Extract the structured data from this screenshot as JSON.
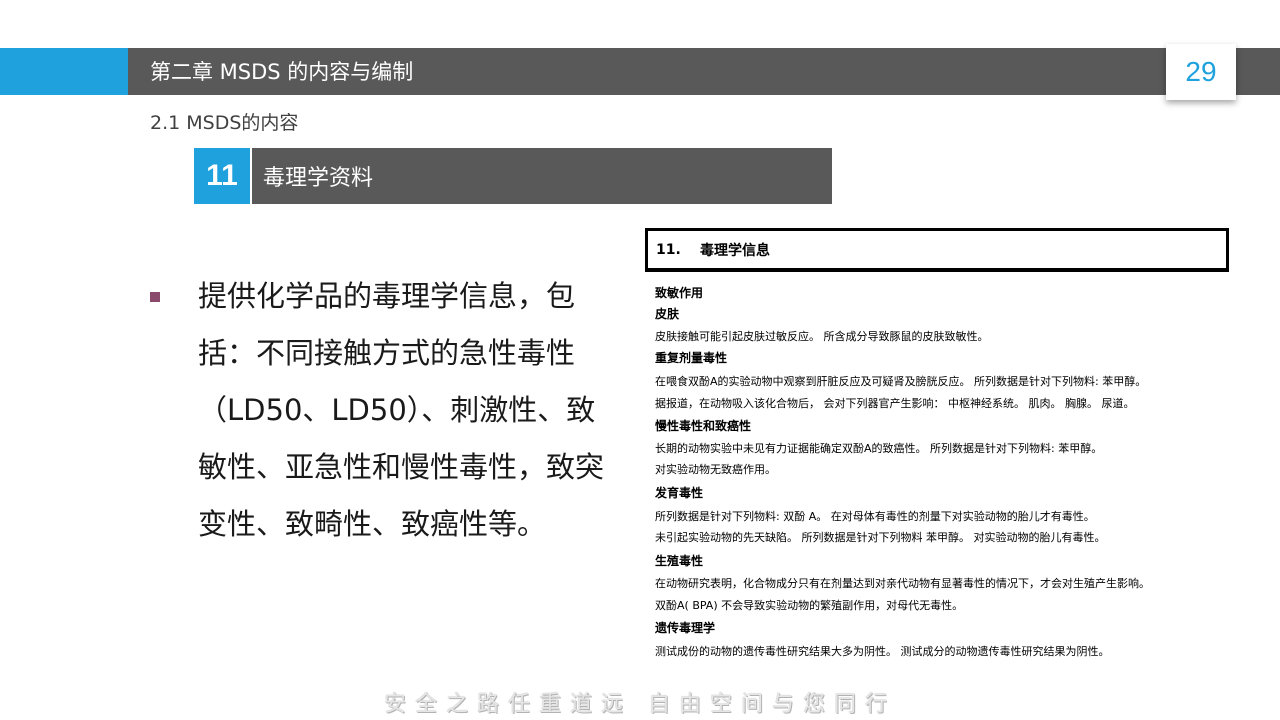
{
  "slide": {
    "chapter_title": "第二章    MSDS 的内容与编制",
    "page_number": "29",
    "subtitle": "2.1  MSDS的内容",
    "section": {
      "number": "11",
      "title": "毒理学资料"
    },
    "body_text": "提供化学品的毒理学信息，包括：不同接触方式的急性毒性（LD50、LD50）、刺激性、致敏性、亚急性和慢性毒性，致突变性、致畸性、致癌性等。",
    "footer": "安全之路任重道远  自由空间与您同行"
  },
  "doc": {
    "head_number": "11.",
    "head_title": "毒理学信息",
    "lines": [
      "致敏作用",
      "皮肤",
      "皮肤接触可能引起皮肤过敏反应。 所含成分导致豚鼠的皮肤致敏性。",
      "重复剂量毒性",
      "在喂食双酚A的实验动物中观察到肝脏反应及可疑肾及膀胱反应。 所列数据是针对下列物料: 苯甲醇。",
      "据报道，在动物吸入该化合物后， 会对下列器官产生影响： 中枢神经系统。 肌肉。 胸腺。 尿道。",
      "慢性毒性和致癌性",
      "长期的动物实验中未见有力证据能确定双酚A的致癌性。 所列数据是针对下列物料: 苯甲醇。",
      "对实验动物无致癌作用。",
      "发育毒性",
      "所列数据是针对下列物料: 双酚 A。 在对母体有毒性的剂量下对实验动物的胎儿才有毒性。",
      "未引起实验动物的先天缺陷。 所列数据是针对下列物料 苯甲醇。 对实验动物的胎儿有毒性。",
      "生殖毒性",
      "在动物研究表明，化合物成分只有在剂量达到对亲代动物有显著毒性的情况下，才会对生殖产生影响。",
      "双酚A( BPA) 不会导致实验动物的繁殖副作用，对母代无毒性。",
      "遗传毒理学",
      "测试成份的动物的遗传毒性研究结果大多为阴性。 测试成分的动物遗传毒性研究结果为阴性。"
    ]
  },
  "colors": {
    "accent": "#1ea1dc",
    "bar": "#595959",
    "bullet": "#8a4a6b"
  }
}
